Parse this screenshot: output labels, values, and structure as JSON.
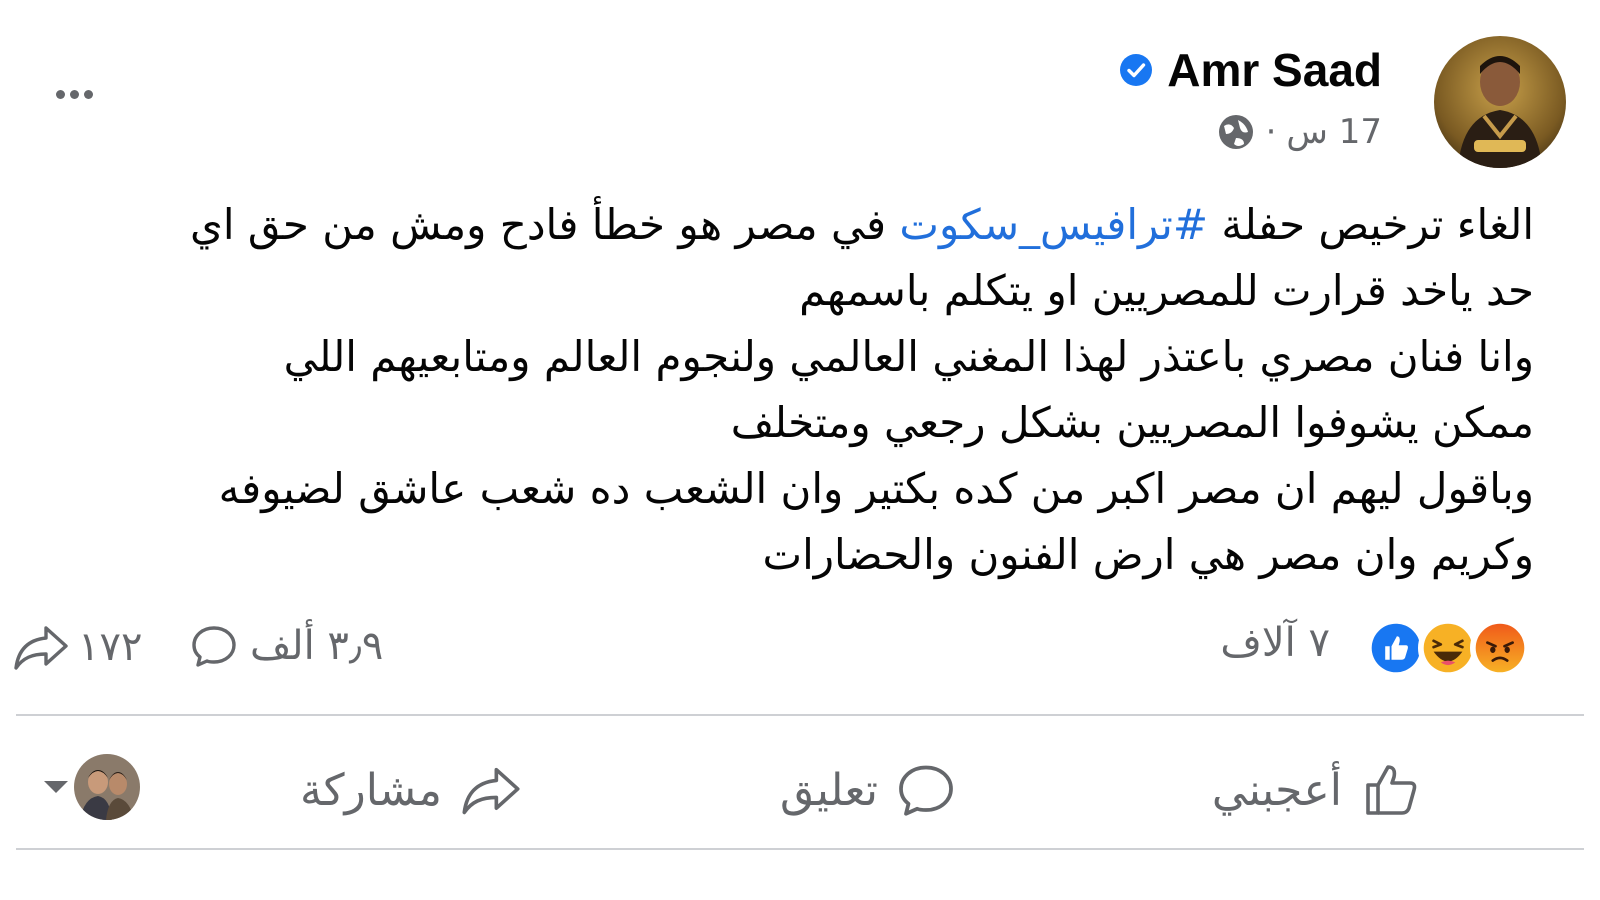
{
  "post": {
    "author": "Amr Saad",
    "time": "17 س",
    "separator": "·",
    "body_lines": [
      {
        "before": "الغاء ترخيص حفلة ",
        "hashtag": "#ترافيس_سكوت",
        "after": " في مصر هو خطأ فادح ومش من حق اي"
      },
      {
        "text": "حد ياخد قرارت للمصريين او يتكلم باسمهم"
      },
      {
        "text": "وانا فنان مصري باعتذر لهذا المغني العالمي ولنجوم العالم ومتابعيهم اللي"
      },
      {
        "text": "ممكن يشوفوا المصريين بشكل رجعي ومتخلف"
      },
      {
        "text": "وباقول ليهم ان مصر اكبر من كده بكتير وان الشعب ده شعب عاشق لضيوفه"
      },
      {
        "text": "وكريم وان مصر هي ارض الفنون والحضارات"
      }
    ]
  },
  "stats": {
    "reactions_count": "٧ آلاف",
    "comments_count": "٣٫٩ ألف",
    "shares_count": "١٧٢",
    "reaction_types": [
      "angry",
      "haha",
      "like"
    ]
  },
  "actions": {
    "like": "أعجبني",
    "comment": "تعليق",
    "share": "مشاركة"
  },
  "colors": {
    "link": "#216fdb",
    "muted": "#65676b",
    "verified": "#1877f2",
    "like": "#1877f2",
    "haha": "#f7b125",
    "angry": "#e9710f"
  }
}
